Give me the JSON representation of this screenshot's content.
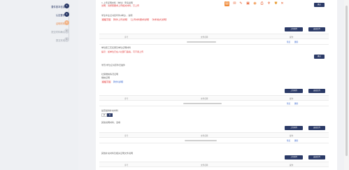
{
  "sidebar": {
    "steps": [
      {
        "label": "要件基本信息",
        "num": "1",
        "state": "done"
      },
      {
        "label": "认定要件",
        "num": "2",
        "state": "done"
      },
      {
        "label": "证明材料",
        "num": "3",
        "state": "active"
      },
      {
        "label": "提交材料确认",
        "num": "4",
        "state": "todo"
      },
      {
        "label": "提交完成",
        "num": "5",
        "state": "todo"
      }
    ]
  },
  "toolbar": {
    "icons": [
      "pdf-icon",
      "share-icon",
      "edit-icon",
      "image-icon",
      "eye-icon",
      "print-icon",
      "stamp-icon",
      "save-icon",
      "close-icon"
    ]
  },
  "sections": [
    {
      "title": "1.上传证明材料（单位）申请说明",
      "note": "说明：请按照要求上传相关材料，已上传"
    },
    {
      "title": "2.学生毕业证书复印件",
      "note": "提示：上传最近的毕业证书扫描件，可以"
    },
    {
      "title": "3.单位职工花名册及证明材料",
      "note": "提示：如单位已在人社部门备案，可不用上传"
    },
    {
      "title": "4.学历证书原件扫描件",
      "note": ""
    },
    {
      "title": "5.缴纳社保情况证明",
      "note": ""
    },
    {
      "title": "6.其他补充材料",
      "note": ""
    }
  ],
  "labels": {
    "top_title": "1.上传证明材料（单位）申请说明",
    "top_note": "说明：请按照要求上传相关材料，已上传",
    "s2_title": "学生毕业证书复印件(单位)，说明",
    "s2_tag": "模板下载",
    "s2_links": "【附件上传说明】 【上传材料要求说明】 【材料格式说明】",
    "s3_title": "单位职工花名册及单位证明材料",
    "s3_note": "提示：如单位已在人社部门备案，可不用上传",
    "s4_title": "学历/学位证书原件扫描件",
    "s5_title": "社保缴纳情况证明",
    "s5_sub1": "缴纳证明",
    "s5_tag": "模板下载",
    "s5_link": "【附件说明】",
    "s6_title": "是否提供补充材料",
    "s6_opt_yes": "是",
    "s6_opt_no": "否",
    "s7_title": "其他说明材料，选填",
    "s8_title": "其他补充材料及相关证明文件说明",
    "btn_upload": "上传附件",
    "btn_select": "选择文件",
    "btn_ok": "确认",
    "col_no": "序号",
    "col_file": "文件名称",
    "col_op": "操作",
    "op_preview": "预览",
    "op_delete": "删除"
  },
  "tables": [
    {
      "rows": 1
    },
    {
      "rows": 1
    },
    {
      "rows": 1
    },
    {
      "rows": 1
    }
  ]
}
